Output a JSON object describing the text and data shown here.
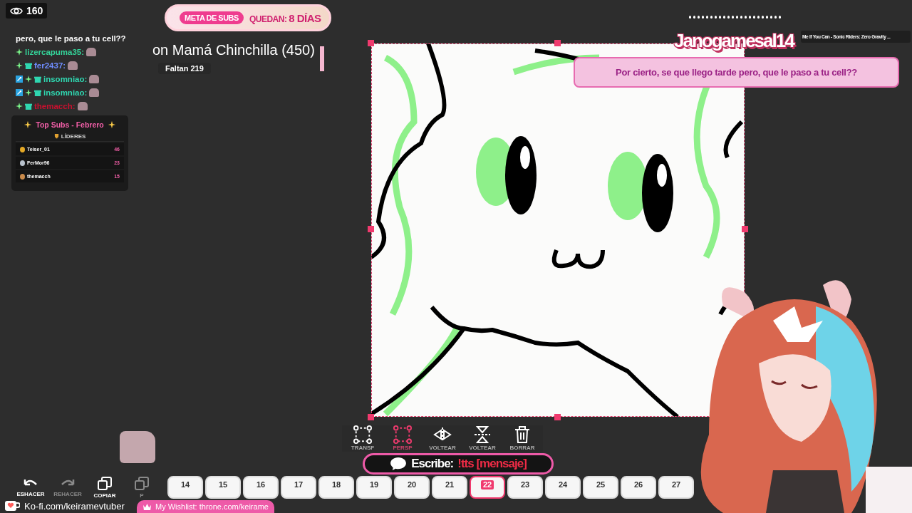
{
  "viewer_count": "160",
  "chat": [
    {
      "kind": "text",
      "text": "pero, que le paso a tu cell??"
    },
    {
      "kind": "user",
      "name": "lizercapuma35:",
      "color": "#34d399",
      "moderator": false,
      "gifter": false
    },
    {
      "kind": "user",
      "name": "fer2437:",
      "color": "#6f8dff",
      "moderator": false,
      "gifter": true
    },
    {
      "kind": "user",
      "name": "insomniao:",
      "color": "#2fd6b0",
      "moderator": true,
      "gifter": true
    },
    {
      "kind": "user",
      "name": "insomniao:",
      "color": "#2fd6b0",
      "moderator": true,
      "gifter": true
    },
    {
      "kind": "user",
      "name": "themacch:",
      "color": "#c8102e",
      "moderator": false,
      "gifter": true
    }
  ],
  "top_subs": {
    "title": "Top Subs - Febrero",
    "header": "LÍDERES",
    "rows": [
      {
        "name": "Teiser_01",
        "count": "46"
      },
      {
        "name": "FerMor96",
        "count": "23"
      },
      {
        "name": "themacch",
        "count": "15"
      }
    ]
  },
  "sub_goal": {
    "badge": "META DE SUBS",
    "label": "QUEDAN:",
    "value": "8 DÍAS"
  },
  "goal": {
    "title": "on Mamá Chinchilla (450)",
    "remaining": "Faltan 219"
  },
  "alert": {
    "name": "Janogamesal14",
    "message": "Por cierto, se que llego tarde pero, que le paso a tu cell??"
  },
  "now_playing": {
    "title": "Me If You Can - Sonic Riders: Zero Gravity ..."
  },
  "edit_tools": [
    {
      "kind": "undo",
      "label": "ESHACER",
      "disabled": false
    },
    {
      "kind": "redo",
      "label": "REHACER",
      "disabled": true
    },
    {
      "kind": "copy",
      "label": "COPIAR",
      "disabled": false
    },
    {
      "kind": "paste",
      "label": "P",
      "disabled": true
    }
  ],
  "transform_tools": [
    {
      "kind": "transform",
      "label": "TRANSF",
      "selected": false
    },
    {
      "kind": "perspective",
      "label": "PERSP",
      "selected": true
    },
    {
      "kind": "flip-h",
      "label": "VOLTEAR",
      "selected": false
    },
    {
      "kind": "flip-v",
      "label": "VOLTEAR",
      "selected": false
    },
    {
      "kind": "delete",
      "label": "BORRAR",
      "selected": false
    }
  ],
  "frames": [
    {
      "number": "14",
      "selected": false
    },
    {
      "number": "15",
      "selected": false
    },
    {
      "number": "16",
      "selected": false
    },
    {
      "number": "17",
      "selected": false
    },
    {
      "number": "18",
      "selected": false
    },
    {
      "number": "19",
      "selected": false
    },
    {
      "number": "20",
      "selected": false
    },
    {
      "number": "21",
      "selected": false
    },
    {
      "number": "22",
      "selected": true
    },
    {
      "number": "23",
      "selected": false
    },
    {
      "number": "24",
      "selected": false
    },
    {
      "number": "25",
      "selected": false
    },
    {
      "number": "26",
      "selected": false
    },
    {
      "number": "27",
      "selected": false
    }
  ],
  "tts": {
    "label": "Escribe:",
    "command": "!tts [mensaje]"
  },
  "kofi": "Ko-fi.com/keiramevtuber",
  "wishlist": "My Wishlist: throne.com/keirame"
}
